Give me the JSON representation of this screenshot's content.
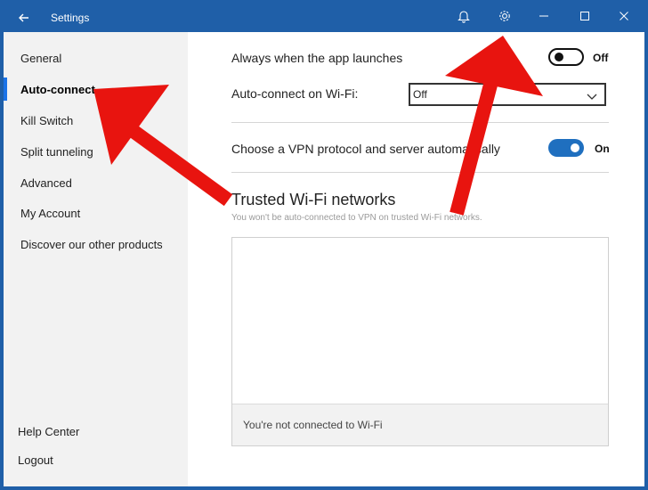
{
  "window": {
    "title": "Settings"
  },
  "titlebar": {
    "icons": [
      "back-arrow-icon",
      "bell-icon",
      "gear-icon",
      "minimize-icon",
      "maximize-icon",
      "close-icon"
    ]
  },
  "sidebar": {
    "items": [
      {
        "label": "General",
        "active": false
      },
      {
        "label": "Auto-connect",
        "active": true
      },
      {
        "label": "Kill Switch",
        "active": false
      },
      {
        "label": "Split tunneling",
        "active": false
      },
      {
        "label": "Advanced",
        "active": false
      },
      {
        "label": "My Account",
        "active": false
      },
      {
        "label": "Discover our other products",
        "active": false
      }
    ],
    "footer": [
      {
        "label": "Help Center"
      },
      {
        "label": "Logout"
      }
    ]
  },
  "main": {
    "launch": {
      "label": "Always when the app launches",
      "state": "Off"
    },
    "wifi": {
      "label": "Auto-connect on Wi-Fi:",
      "selected": "Off"
    },
    "protocol": {
      "label": "Choose a VPN protocol and server automatically",
      "state": "On"
    },
    "trusted": {
      "title": "Trusted Wi-Fi networks",
      "subtitle": "You won't be auto-connected to VPN on trusted Wi-Fi networks.",
      "empty": "You're not connected to Wi-Fi"
    }
  },
  "colors": {
    "titlebar": "#1f5fa8",
    "accent": "#1a73e8",
    "toggle_on": "#1f6fbf",
    "sidebar_bg": "#f2f2f2",
    "annotation_arrow": "#e8140f"
  }
}
